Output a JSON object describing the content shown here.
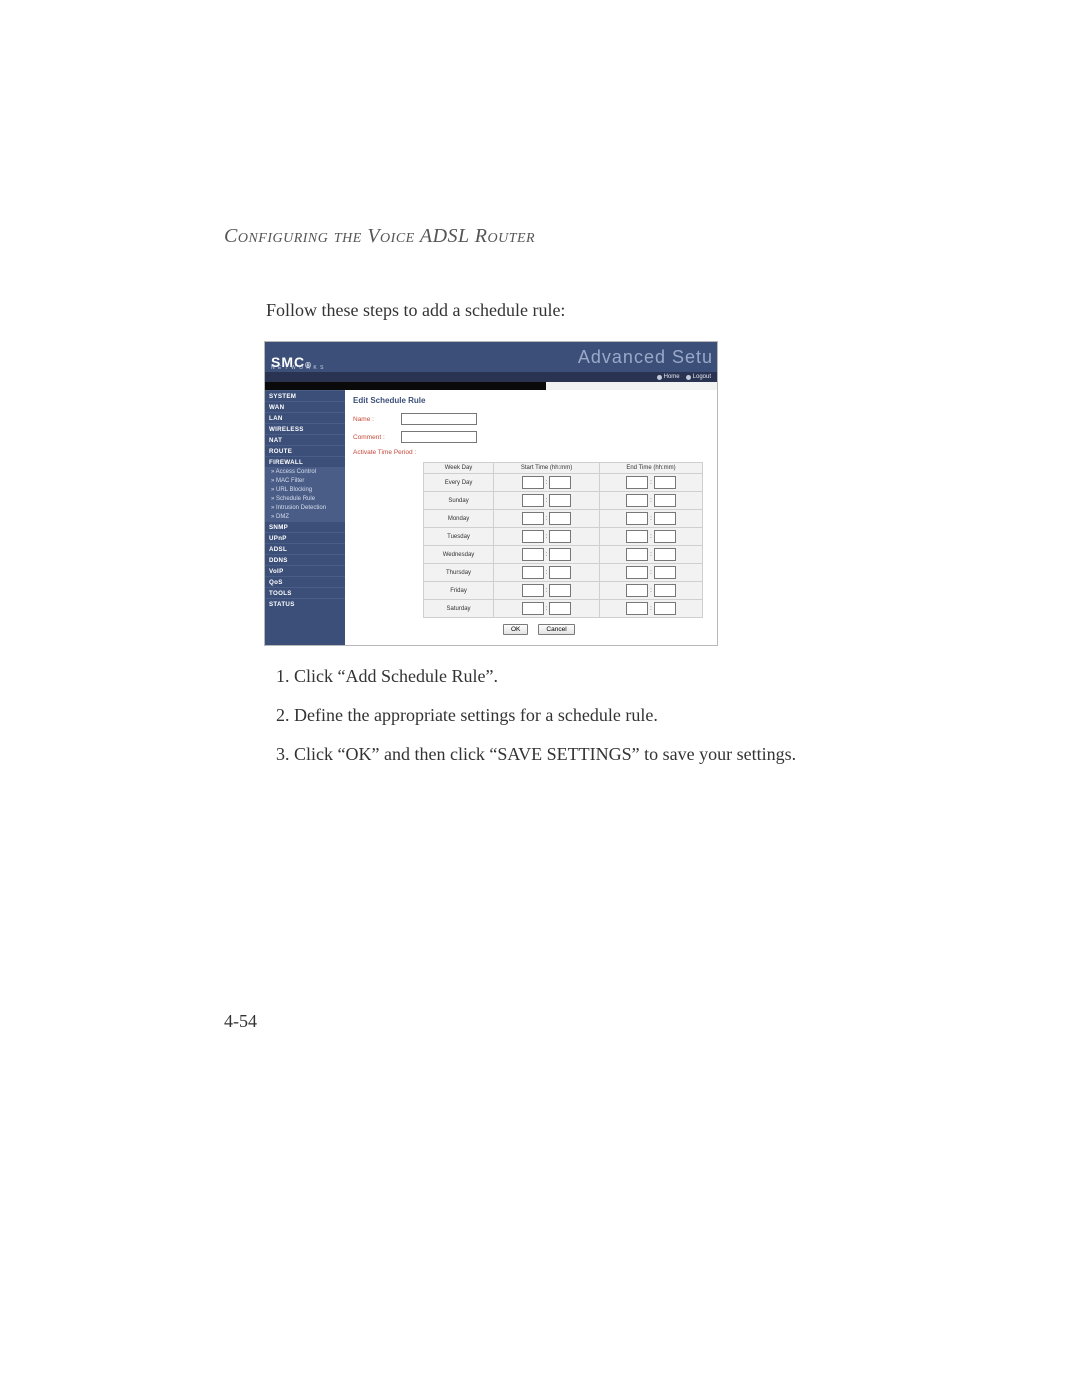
{
  "doc": {
    "header": "Configuring the Voice ADSL Router",
    "intro": "Follow these steps to add a schedule rule:",
    "steps": [
      "Click “Add Schedule Rule”.",
      "Define the appropriate settings for a schedule rule.",
      "Click “OK” and then click “SAVE SETTINGS” to save your settings."
    ],
    "page_number": "4-54"
  },
  "screenshot": {
    "brand": "SMC",
    "brand_reg": "®",
    "brand_sub": "N E T W O R K S",
    "title": "Advanced Setu",
    "toplinks": {
      "home": "Home",
      "logout": "Logout"
    },
    "sidebar": {
      "items": [
        {
          "label": "SYSTEM",
          "type": "item"
        },
        {
          "label": "WAN",
          "type": "item"
        },
        {
          "label": "LAN",
          "type": "item"
        },
        {
          "label": "WIRELESS",
          "type": "item"
        },
        {
          "label": "NAT",
          "type": "item"
        },
        {
          "label": "ROUTE",
          "type": "item"
        },
        {
          "label": "FIREWALL",
          "type": "item"
        },
        {
          "label": "» Access Control",
          "type": "sub"
        },
        {
          "label": "» MAC Filter",
          "type": "sub"
        },
        {
          "label": "» URL Blocking",
          "type": "sub"
        },
        {
          "label": "» Schedule Rule",
          "type": "sub"
        },
        {
          "label": "» Intrusion Detection",
          "type": "sub"
        },
        {
          "label": "» DMZ",
          "type": "sub"
        },
        {
          "label": "SNMP",
          "type": "item"
        },
        {
          "label": "UPnP",
          "type": "item"
        },
        {
          "label": "ADSL",
          "type": "item"
        },
        {
          "label": "DDNS",
          "type": "item"
        },
        {
          "label": "VoIP",
          "type": "item"
        },
        {
          "label": "QoS",
          "type": "item"
        },
        {
          "label": "TOOLS",
          "type": "item"
        },
        {
          "label": "STATUS",
          "type": "item"
        }
      ]
    },
    "content": {
      "title": "Edit Schedule Rule",
      "name_label": "Name :",
      "name_value": "",
      "comment_label": "Comment :",
      "comment_value": "",
      "atp": "Activate Time Period :",
      "headers": {
        "week": "Week Day",
        "start": "Start Time (hh:mm)",
        "end": "End Time (hh:mm)"
      },
      "days": [
        "Every Day",
        "Sunday",
        "Monday",
        "Tuesday",
        "Wednesday",
        "Thursday",
        "Friday",
        "Saturday"
      ],
      "btn_ok": "OK",
      "btn_cancel": "Cancel"
    }
  }
}
